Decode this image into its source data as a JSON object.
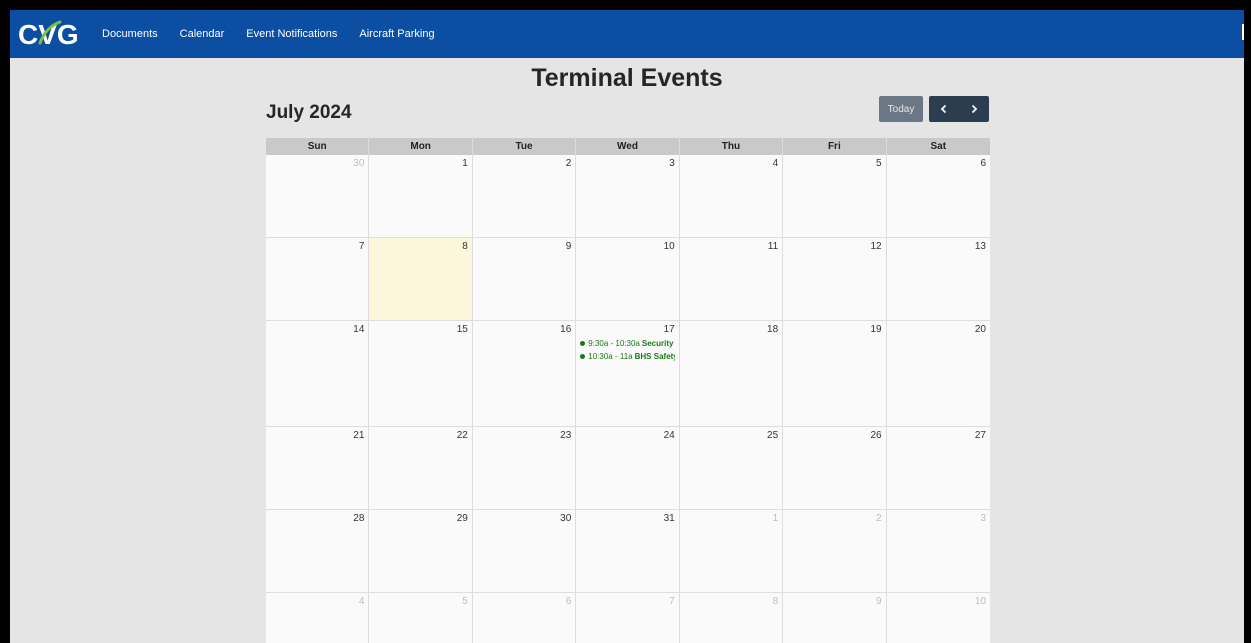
{
  "nav": {
    "logo_text": "CVG",
    "links": [
      "Documents",
      "Calendar",
      "Event Notifications",
      "Aircraft Parking"
    ]
  },
  "page": {
    "title": "Terminal Events",
    "month_label": "July 2024",
    "today_label": "Today"
  },
  "calendar": {
    "days_of_week": [
      "Sun",
      "Mon",
      "Tue",
      "Wed",
      "Thu",
      "Fri",
      "Sat"
    ],
    "weeks": [
      [
        {
          "n": "30",
          "other": true
        },
        {
          "n": "1"
        },
        {
          "n": "2"
        },
        {
          "n": "3"
        },
        {
          "n": "4"
        },
        {
          "n": "5"
        },
        {
          "n": "6"
        }
      ],
      [
        {
          "n": "7"
        },
        {
          "n": "8",
          "today": true
        },
        {
          "n": "9"
        },
        {
          "n": "10"
        },
        {
          "n": "11"
        },
        {
          "n": "12"
        },
        {
          "n": "13"
        }
      ],
      [
        {
          "n": "14"
        },
        {
          "n": "15"
        },
        {
          "n": "16"
        },
        {
          "n": "17",
          "events": [
            {
              "time": "9:30a - 10:30a",
              "title": "Security"
            },
            {
              "time": "10:30a - 11a",
              "title": "BHS Safety"
            }
          ]
        },
        {
          "n": "18"
        },
        {
          "n": "19"
        },
        {
          "n": "20"
        }
      ],
      [
        {
          "n": "21"
        },
        {
          "n": "22"
        },
        {
          "n": "23"
        },
        {
          "n": "24"
        },
        {
          "n": "25"
        },
        {
          "n": "26"
        },
        {
          "n": "27"
        }
      ],
      [
        {
          "n": "28"
        },
        {
          "n": "29"
        },
        {
          "n": "30"
        },
        {
          "n": "31"
        },
        {
          "n": "1",
          "other": true
        },
        {
          "n": "2",
          "other": true
        },
        {
          "n": "3",
          "other": true
        }
      ],
      [
        {
          "n": "4",
          "other": true
        },
        {
          "n": "5",
          "other": true
        },
        {
          "n": "6",
          "other": true
        },
        {
          "n": "7",
          "other": true
        },
        {
          "n": "8",
          "other": true
        },
        {
          "n": "9",
          "other": true
        },
        {
          "n": "10",
          "other": true
        }
      ]
    ]
  },
  "colors": {
    "nav_bg": "#0b4ea2",
    "event": "#177a17",
    "today_bg": "#fcf6dc",
    "logo_swoosh": "#7fbf3f"
  }
}
